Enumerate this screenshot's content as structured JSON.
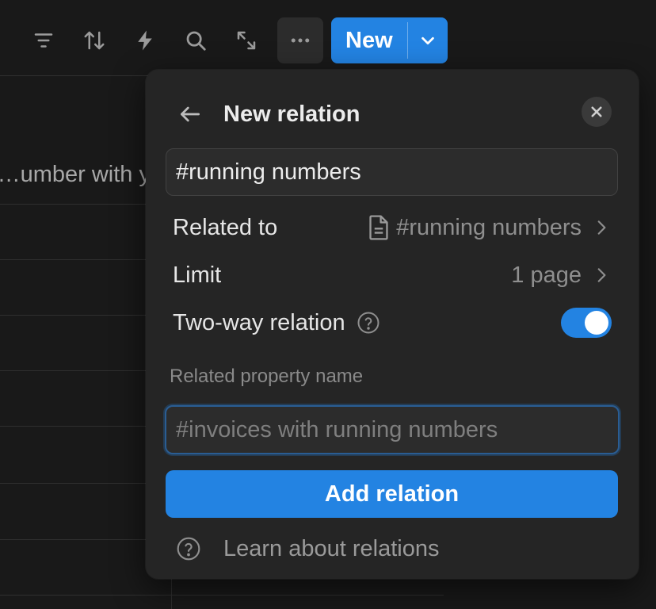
{
  "background": {
    "cell_text": "umber with y…"
  },
  "toolbar": {
    "icons": [
      "filter-icon",
      "sort-icon",
      "automation-bolt-icon",
      "search-icon",
      "expand-icon",
      "more-icon"
    ],
    "new_label": "New"
  },
  "popover": {
    "title": "New relation",
    "name_value": "#running numbers",
    "rows": {
      "related_to": {
        "label": "Related to",
        "value": "#running numbers"
      },
      "limit": {
        "label": "Limit",
        "value": "1 page"
      },
      "two_way": {
        "label": "Two-way relation",
        "enabled": true
      }
    },
    "related_property_label": "Related property name",
    "related_property_placeholder": "#invoices with running numbers",
    "add_button_label": "Add relation",
    "learn_link": "Learn about relations"
  },
  "colors": {
    "accent": "#2383e2",
    "background": "#191919",
    "popover": "#252525"
  }
}
